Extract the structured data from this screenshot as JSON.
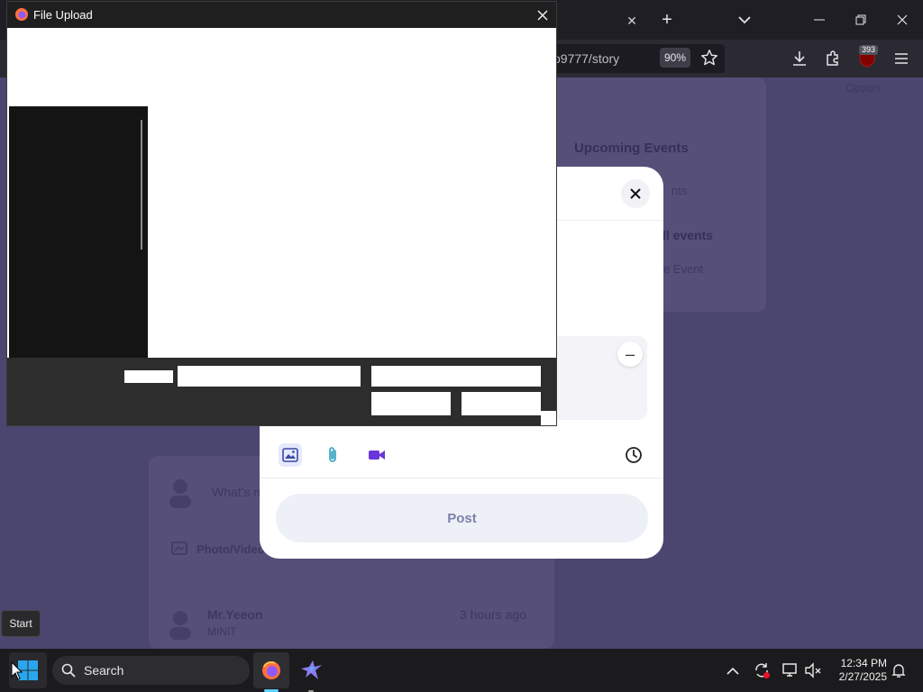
{
  "browser": {
    "url_fragment": "o9777/story",
    "zoom_level": "90%",
    "extension_badge_count": "393",
    "icons": [
      "tab-close-icon",
      "new-tab-icon",
      "tab-list-chevron-icon",
      "minimize-icon",
      "restore-icon",
      "close-icon",
      "bookmark-star-icon",
      "download-icon",
      "extensions-icon",
      "ublock-icon",
      "menu-icon"
    ]
  },
  "page_background": {
    "dropdown_text": "Option",
    "upcoming_events_heading": "Upcoming Events",
    "events_line": "nts",
    "all_events_link": "ll events",
    "create_event_link": "e Event",
    "whats_new_prompt": "What's n",
    "photo_video_label": "Photo/Video",
    "feed_author": "Mr.Yeeon",
    "feed_author_sub": "MINIT",
    "feed_time": "3 hours ago"
  },
  "post_modal": {
    "post_button_label": "Post",
    "remove_attachment_symbol": "–",
    "tools": [
      "image-icon",
      "paperclip-icon",
      "video-icon",
      "clock-icon"
    ]
  },
  "file_upload_dialog": {
    "title": "File Upload"
  },
  "taskbar": {
    "tooltip": "Start",
    "search_label": "Search",
    "time": "12:34 PM",
    "date": "2/27/2025",
    "accent": "#60cdff"
  }
}
